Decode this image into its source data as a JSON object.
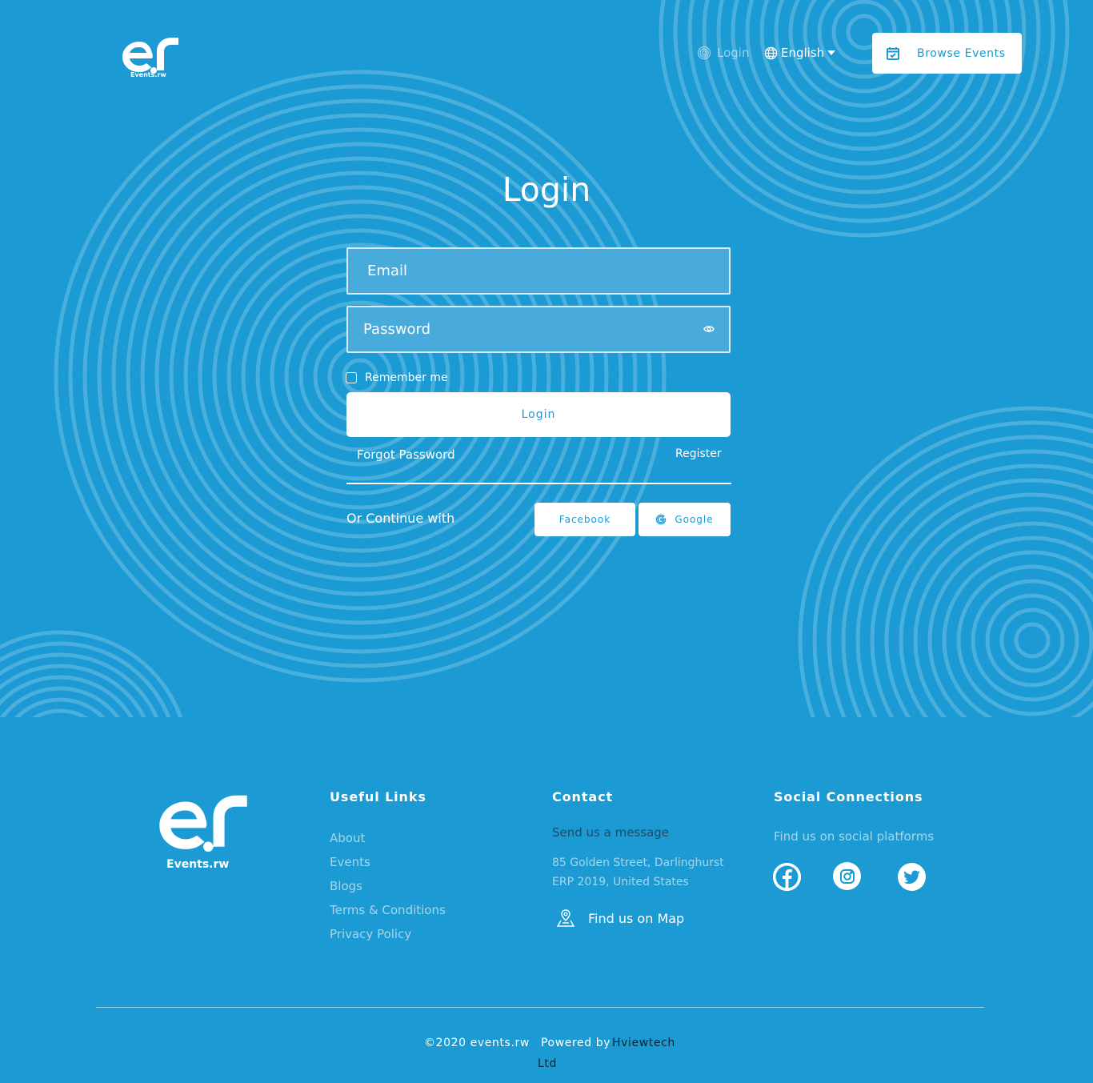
{
  "header": {
    "logo_text": "Events.rw",
    "nav_login": "Login",
    "language": "English",
    "browse_events": "Browse Events"
  },
  "login_form": {
    "title": "Login",
    "email_placeholder": "Email",
    "password_placeholder": "Password",
    "remember_me": "Remember me",
    "submit": "Login",
    "forgot_password": "Forgot Password",
    "register": "Register",
    "or_continue": "Or Continue with",
    "facebook": "Facebook",
    "google": "Google"
  },
  "footer": {
    "logo_text": "Events.rw",
    "useful_links": {
      "heading": "Useful Links",
      "items": [
        "About",
        "Events",
        "Blogs",
        "Terms & Conditions",
        "Privacy Policy"
      ]
    },
    "contact": {
      "heading": "Contact",
      "message": "Send us a message",
      "address_line1": "85 Golden Street, Darlinghurst",
      "address_line2": "ERP 2019, United States",
      "find_map": "Find us on Map"
    },
    "social": {
      "heading": "Social Connections",
      "text": "Find us on social platforms",
      "icons": [
        "facebook-icon",
        "instagram-icon",
        "twitter-icon"
      ]
    },
    "copyright": "©2020 events.rw",
    "powered_by": "Powered by",
    "company_line1": "Hviewtech",
    "company_line2": "Ltd"
  },
  "colors": {
    "background": "#1b9ad3",
    "field_bg": "#49abdc",
    "white": "#ffffff",
    "dark_text": "#1c4c6a"
  }
}
